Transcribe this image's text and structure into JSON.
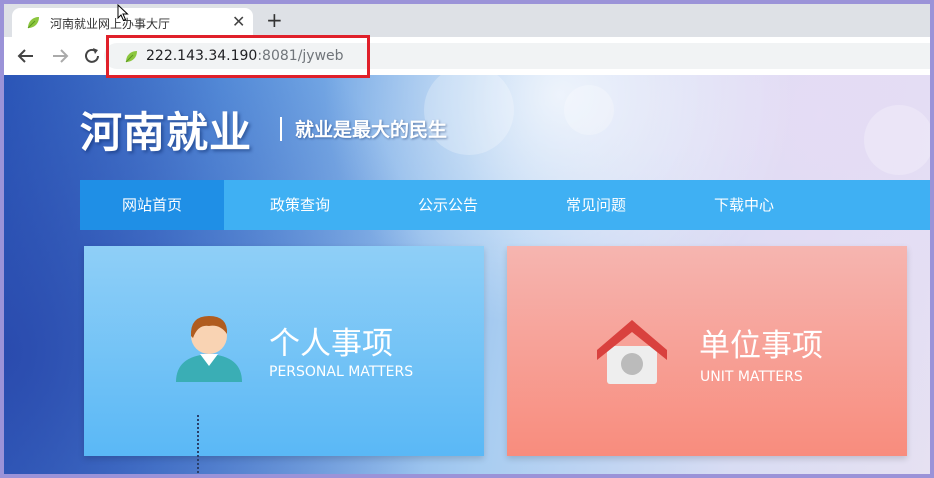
{
  "browser": {
    "tab_title": "河南就业网上办事大厅",
    "tab_close": "✕",
    "new_tab": "+",
    "url_host": "222.143.34.190",
    "url_rest": ":8081/jyweb"
  },
  "site": {
    "logo": "河南就业",
    "slogan": "就业是最大的民生",
    "nav": [
      {
        "label": "网站首页",
        "active": true
      },
      {
        "label": "政策查询",
        "active": false
      },
      {
        "label": "公示公告",
        "active": false
      },
      {
        "label": "常见问题",
        "active": false
      },
      {
        "label": "下载中心",
        "active": false
      }
    ],
    "cards": {
      "personal": {
        "title": "个人事项",
        "subtitle": "PERSONAL MATTERS",
        "icon": "person-icon"
      },
      "unit": {
        "title": "单位事项",
        "subtitle": "UNIT MATTERS",
        "icon": "house-icon"
      }
    }
  },
  "colors": {
    "nav_bar": "#3fb0f3",
    "nav_active": "#1f8fe6",
    "highlight_box": "#e0202a"
  }
}
